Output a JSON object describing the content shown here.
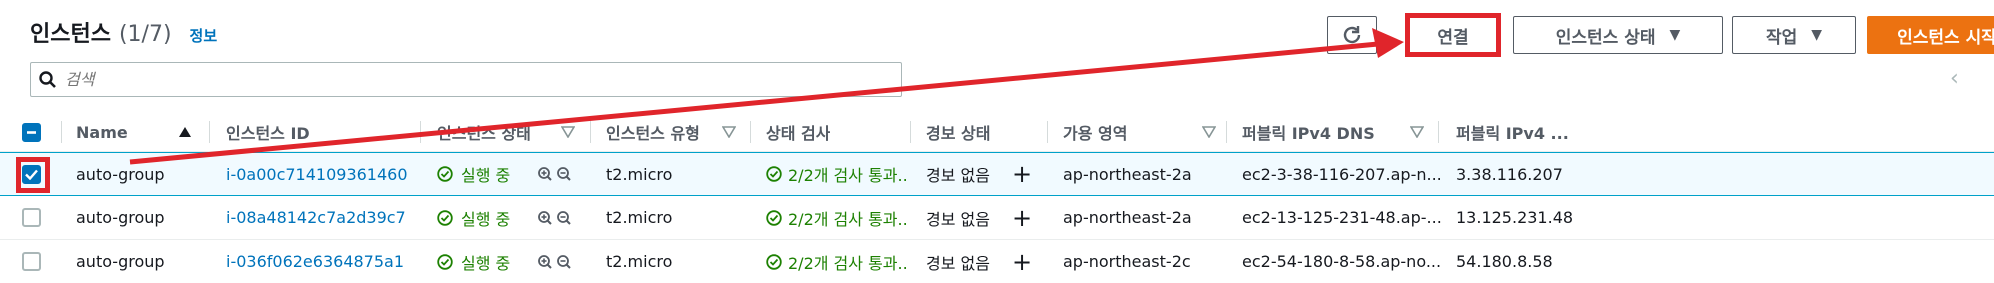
{
  "header": {
    "title": "인스턴스",
    "count": "(1/7)",
    "info_link": "정보"
  },
  "toolbar": {
    "refresh_icon": "refresh-icon",
    "connect_label": "연결",
    "instance_state_label": "인스턴스 상태",
    "actions_label": "작업",
    "launch_label": "인스턴스 시작"
  },
  "search": {
    "placeholder": "검색",
    "icon": "search-icon"
  },
  "table": {
    "columns": [
      "Name",
      "인스턴스 ID",
      "인스턴스 상태",
      "인스턴스 유형",
      "상태 검사",
      "경보 상태",
      "가용 영역",
      "퍼블릭 IPv4 DNS",
      "퍼블릭 IPv4 ..."
    ],
    "rows": [
      {
        "selected": true,
        "name": "auto-group",
        "instance_id": "i-0a00c714109361460",
        "state": "실행 중",
        "type": "t2.micro",
        "status_check": "2/2개 검사 통과...",
        "alarm": "경보 없음",
        "az": "ap-northeast-2a",
        "dns": "ec2-3-38-116-207.ap-n...",
        "ip": "3.38.116.207"
      },
      {
        "selected": false,
        "name": "auto-group",
        "instance_id": "i-08a48142c7a2d39c7",
        "state": "실행 중",
        "type": "t2.micro",
        "status_check": "2/2개 검사 통과...",
        "alarm": "경보 없음",
        "az": "ap-northeast-2a",
        "dns": "ec2-13-125-231-48.ap-...",
        "ip": "13.125.231.48"
      },
      {
        "selected": false,
        "name": "auto-group",
        "instance_id": "i-036f062e6364875a1",
        "state": "실행 중",
        "type": "t2.micro",
        "status_check": "2/2개 검사 통과...",
        "alarm": "경보 없음",
        "az": "ap-northeast-2c",
        "dns": "ec2-54-180-8-58.ap-no...",
        "ip": "54.180.8.58"
      }
    ]
  },
  "colors": {
    "annotation_red": "#e0252b",
    "link_blue": "#0073bb",
    "ok_green": "#1d8102",
    "launch_orange": "#ec7211"
  }
}
